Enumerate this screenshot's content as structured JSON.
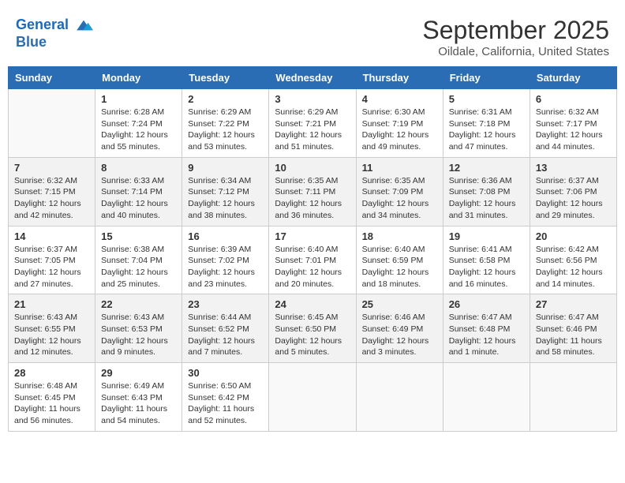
{
  "header": {
    "logo_line1": "General",
    "logo_line2": "Blue",
    "month": "September 2025",
    "location": "Oildale, California, United States"
  },
  "days_of_week": [
    "Sunday",
    "Monday",
    "Tuesday",
    "Wednesday",
    "Thursday",
    "Friday",
    "Saturday"
  ],
  "weeks": [
    [
      {
        "day": "",
        "info": ""
      },
      {
        "day": "1",
        "info": "Sunrise: 6:28 AM\nSunset: 7:24 PM\nDaylight: 12 hours\nand 55 minutes."
      },
      {
        "day": "2",
        "info": "Sunrise: 6:29 AM\nSunset: 7:22 PM\nDaylight: 12 hours\nand 53 minutes."
      },
      {
        "day": "3",
        "info": "Sunrise: 6:29 AM\nSunset: 7:21 PM\nDaylight: 12 hours\nand 51 minutes."
      },
      {
        "day": "4",
        "info": "Sunrise: 6:30 AM\nSunset: 7:19 PM\nDaylight: 12 hours\nand 49 minutes."
      },
      {
        "day": "5",
        "info": "Sunrise: 6:31 AM\nSunset: 7:18 PM\nDaylight: 12 hours\nand 47 minutes."
      },
      {
        "day": "6",
        "info": "Sunrise: 6:32 AM\nSunset: 7:17 PM\nDaylight: 12 hours\nand 44 minutes."
      }
    ],
    [
      {
        "day": "7",
        "info": "Sunrise: 6:32 AM\nSunset: 7:15 PM\nDaylight: 12 hours\nand 42 minutes."
      },
      {
        "day": "8",
        "info": "Sunrise: 6:33 AM\nSunset: 7:14 PM\nDaylight: 12 hours\nand 40 minutes."
      },
      {
        "day": "9",
        "info": "Sunrise: 6:34 AM\nSunset: 7:12 PM\nDaylight: 12 hours\nand 38 minutes."
      },
      {
        "day": "10",
        "info": "Sunrise: 6:35 AM\nSunset: 7:11 PM\nDaylight: 12 hours\nand 36 minutes."
      },
      {
        "day": "11",
        "info": "Sunrise: 6:35 AM\nSunset: 7:09 PM\nDaylight: 12 hours\nand 34 minutes."
      },
      {
        "day": "12",
        "info": "Sunrise: 6:36 AM\nSunset: 7:08 PM\nDaylight: 12 hours\nand 31 minutes."
      },
      {
        "day": "13",
        "info": "Sunrise: 6:37 AM\nSunset: 7:06 PM\nDaylight: 12 hours\nand 29 minutes."
      }
    ],
    [
      {
        "day": "14",
        "info": "Sunrise: 6:37 AM\nSunset: 7:05 PM\nDaylight: 12 hours\nand 27 minutes."
      },
      {
        "day": "15",
        "info": "Sunrise: 6:38 AM\nSunset: 7:04 PM\nDaylight: 12 hours\nand 25 minutes."
      },
      {
        "day": "16",
        "info": "Sunrise: 6:39 AM\nSunset: 7:02 PM\nDaylight: 12 hours\nand 23 minutes."
      },
      {
        "day": "17",
        "info": "Sunrise: 6:40 AM\nSunset: 7:01 PM\nDaylight: 12 hours\nand 20 minutes."
      },
      {
        "day": "18",
        "info": "Sunrise: 6:40 AM\nSunset: 6:59 PM\nDaylight: 12 hours\nand 18 minutes."
      },
      {
        "day": "19",
        "info": "Sunrise: 6:41 AM\nSunset: 6:58 PM\nDaylight: 12 hours\nand 16 minutes."
      },
      {
        "day": "20",
        "info": "Sunrise: 6:42 AM\nSunset: 6:56 PM\nDaylight: 12 hours\nand 14 minutes."
      }
    ],
    [
      {
        "day": "21",
        "info": "Sunrise: 6:43 AM\nSunset: 6:55 PM\nDaylight: 12 hours\nand 12 minutes."
      },
      {
        "day": "22",
        "info": "Sunrise: 6:43 AM\nSunset: 6:53 PM\nDaylight: 12 hours\nand 9 minutes."
      },
      {
        "day": "23",
        "info": "Sunrise: 6:44 AM\nSunset: 6:52 PM\nDaylight: 12 hours\nand 7 minutes."
      },
      {
        "day": "24",
        "info": "Sunrise: 6:45 AM\nSunset: 6:50 PM\nDaylight: 12 hours\nand 5 minutes."
      },
      {
        "day": "25",
        "info": "Sunrise: 6:46 AM\nSunset: 6:49 PM\nDaylight: 12 hours\nand 3 minutes."
      },
      {
        "day": "26",
        "info": "Sunrise: 6:47 AM\nSunset: 6:48 PM\nDaylight: 12 hours\nand 1 minute."
      },
      {
        "day": "27",
        "info": "Sunrise: 6:47 AM\nSunset: 6:46 PM\nDaylight: 11 hours\nand 58 minutes."
      }
    ],
    [
      {
        "day": "28",
        "info": "Sunrise: 6:48 AM\nSunset: 6:45 PM\nDaylight: 11 hours\nand 56 minutes."
      },
      {
        "day": "29",
        "info": "Sunrise: 6:49 AM\nSunset: 6:43 PM\nDaylight: 11 hours\nand 54 minutes."
      },
      {
        "day": "30",
        "info": "Sunrise: 6:50 AM\nSunset: 6:42 PM\nDaylight: 11 hours\nand 52 minutes."
      },
      {
        "day": "",
        "info": ""
      },
      {
        "day": "",
        "info": ""
      },
      {
        "day": "",
        "info": ""
      },
      {
        "day": "",
        "info": ""
      }
    ]
  ]
}
